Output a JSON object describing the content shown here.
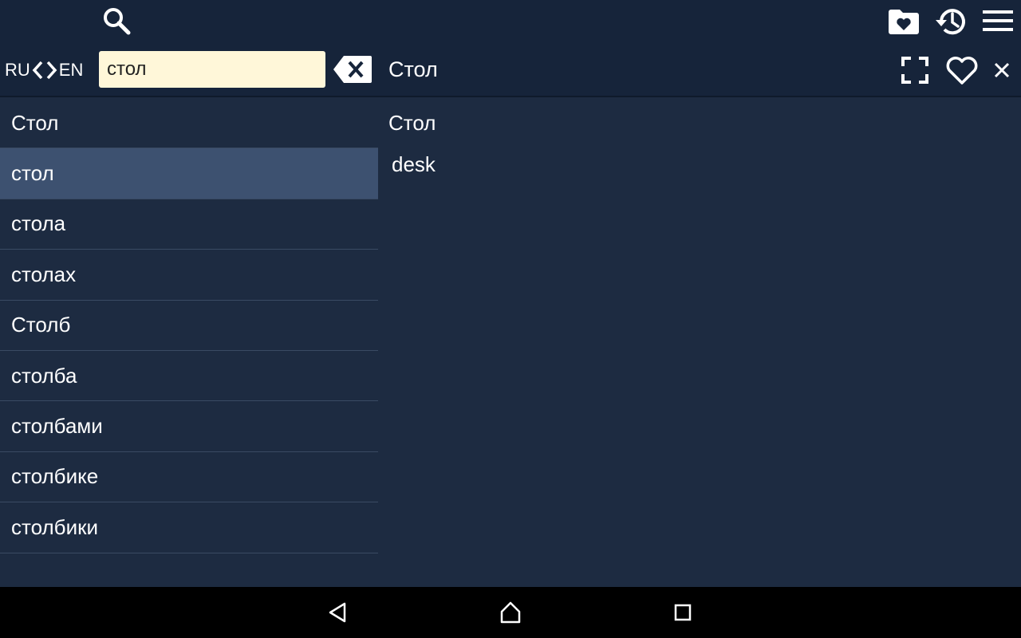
{
  "toolbar": {
    "lang_from": "RU",
    "lang_to": "EN",
    "search_value": "стол",
    "entry_title": "Стол"
  },
  "icons": {
    "search": "search-icon",
    "favorites_folder": "heart-folder-icon",
    "history": "history-icon",
    "menu": "hamburger-menu-icon",
    "clear": "backspace-clear-icon",
    "fullscreen": "fullscreen-icon",
    "favorite": "heart-outline-icon",
    "close": "close-icon"
  },
  "word_list": [
    {
      "label": "Стол",
      "selected": false
    },
    {
      "label": "стол",
      "selected": true
    },
    {
      "label": "стола",
      "selected": false
    },
    {
      "label": "столах",
      "selected": false
    },
    {
      "label": "Столб",
      "selected": false
    },
    {
      "label": "столба",
      "selected": false
    },
    {
      "label": "столбами",
      "selected": false
    },
    {
      "label": "столбике",
      "selected": false
    },
    {
      "label": "столбики",
      "selected": false
    }
  ],
  "entry": {
    "heading": "Стол",
    "translation": "desk"
  },
  "colors": {
    "background": "#1d2b41",
    "toolbar": "#16243a",
    "selected_row": "#3d5170",
    "search_field": "#fff7d9"
  }
}
